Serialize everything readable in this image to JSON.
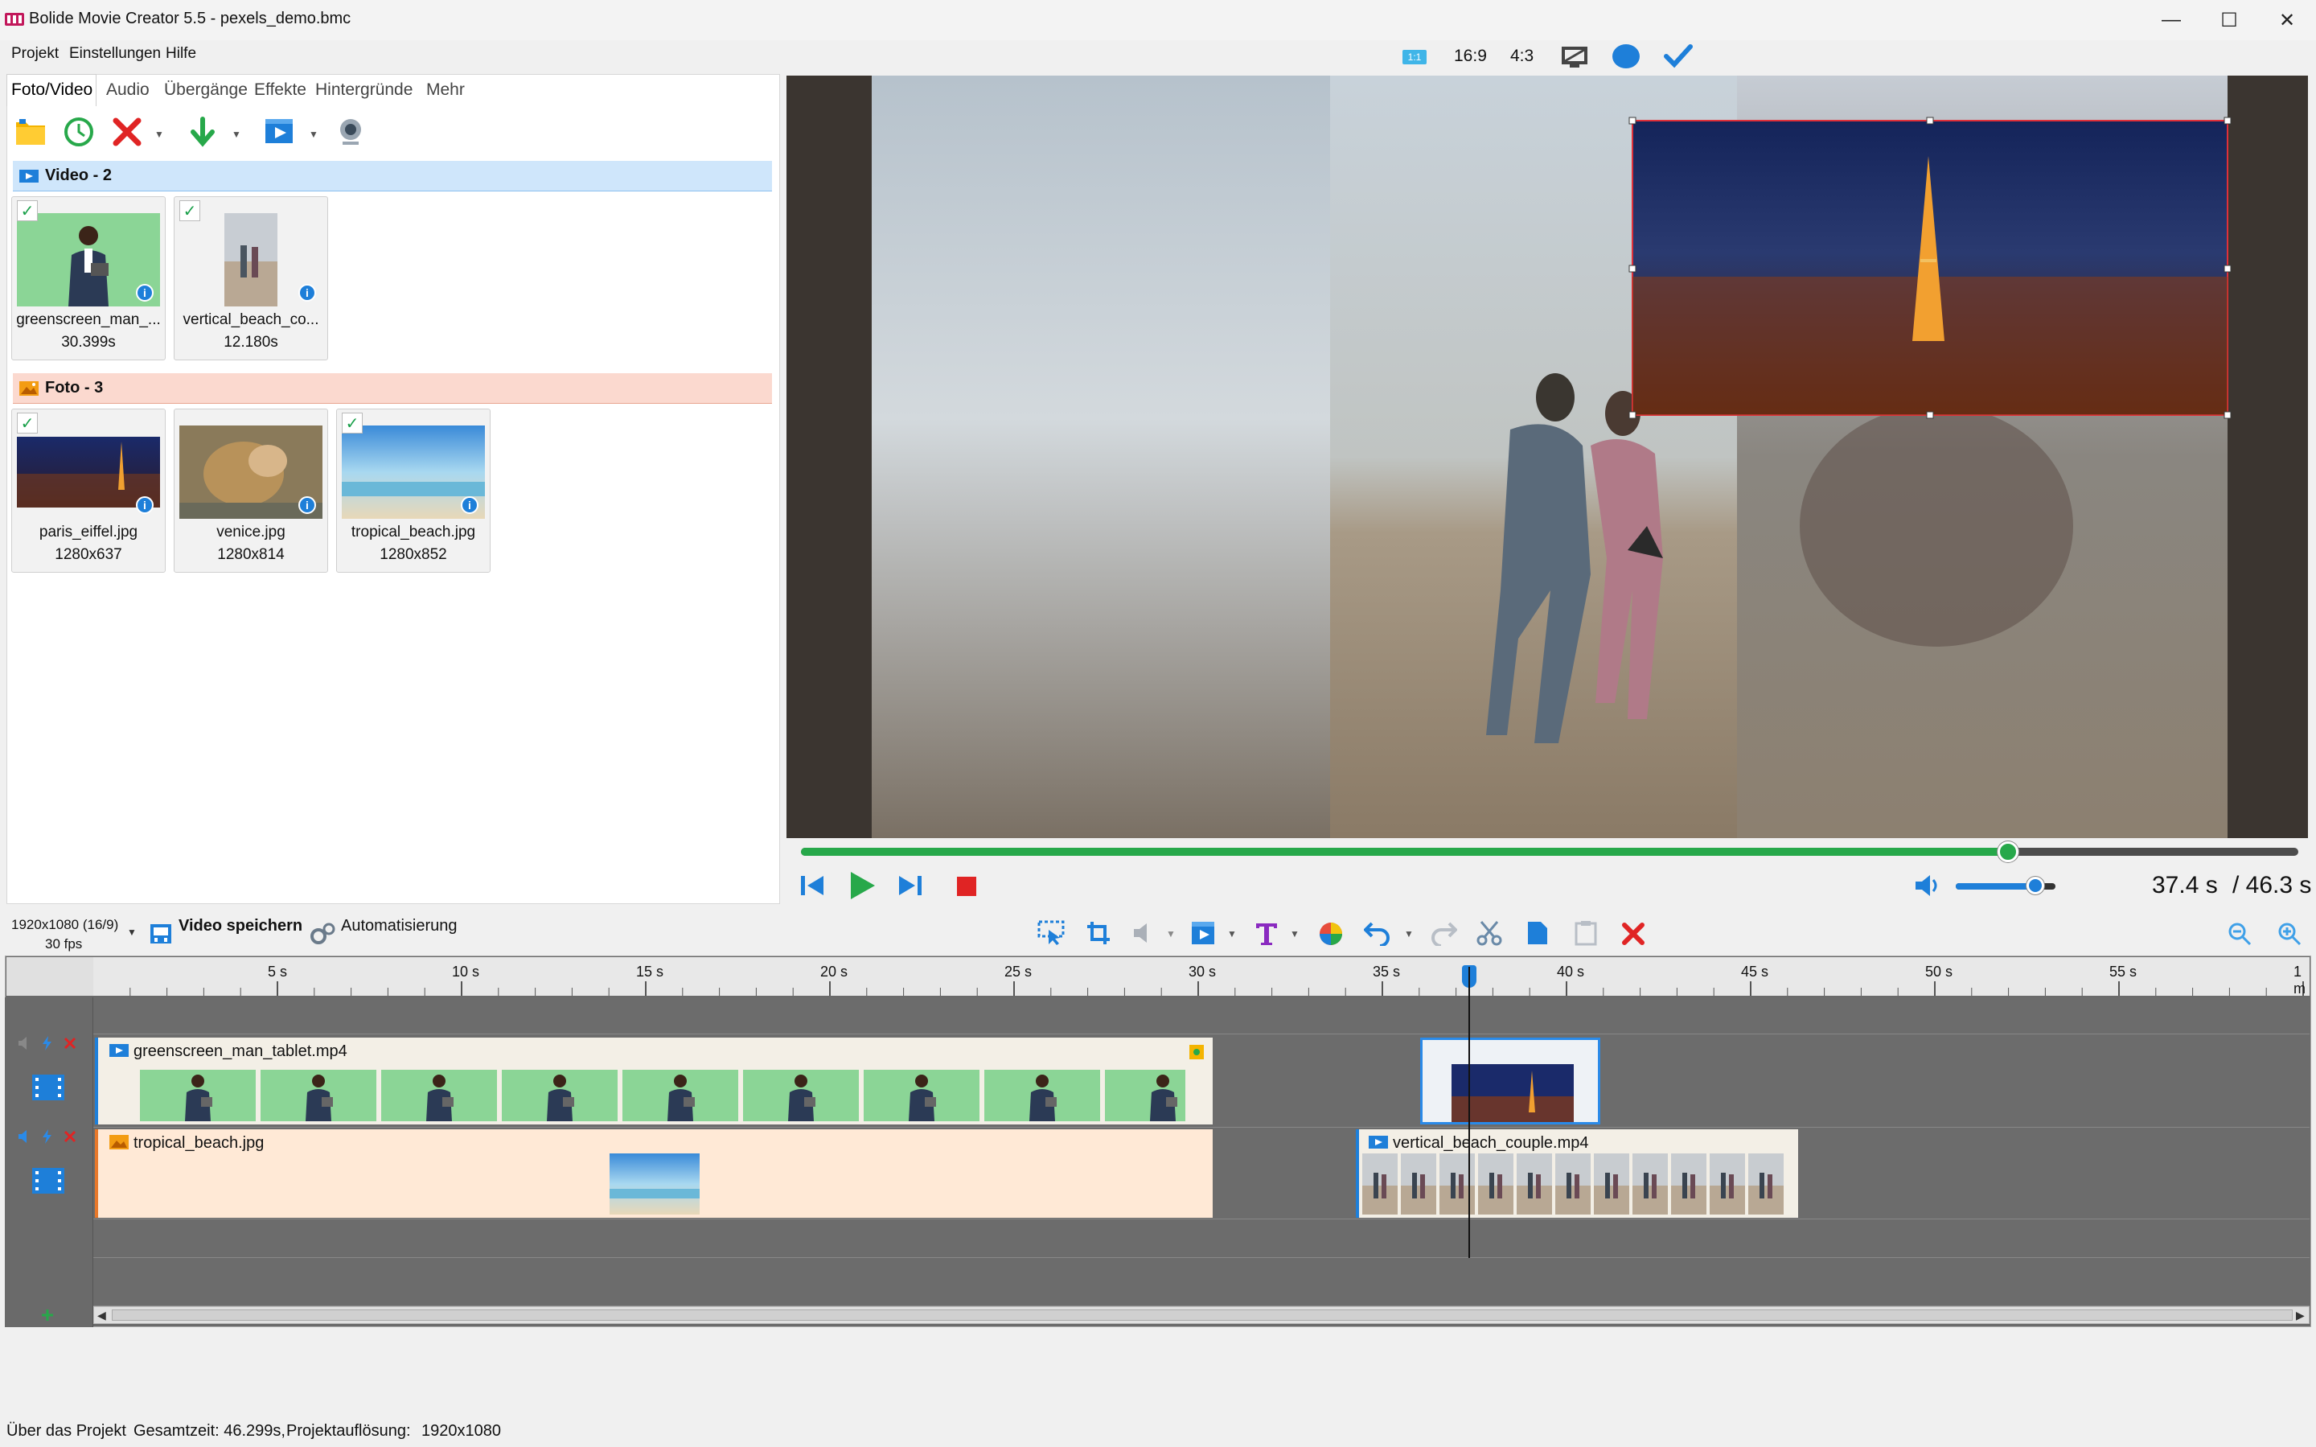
{
  "window": {
    "title": "Bolide Movie Creator 5.5 - pexels_demo.bmc",
    "minimize": "—",
    "maximize": "☐",
    "close": "✕"
  },
  "menu": [
    "Projekt",
    "Einstellungen",
    "Hilfe"
  ],
  "preview_toolbar": {
    "ratio_1_1": "1:1",
    "ratio_16_9": "16:9",
    "ratio_4_3": "4:3"
  },
  "tabs": [
    "Foto/Video",
    "Audio",
    "Übergänge",
    "Effekte",
    "Hintergründe",
    "Mehr"
  ],
  "groups": {
    "video": {
      "label": "Video - 2",
      "items": [
        {
          "name": "greenscreen_man_...",
          "info": "30.399s"
        },
        {
          "name": "vertical_beach_co...",
          "info": "12.180s"
        }
      ]
    },
    "photo": {
      "label": "Foto - 3",
      "items": [
        {
          "name": "paris_eiffel.jpg",
          "info": "1280x637"
        },
        {
          "name": "venice.jpg",
          "info": "1280x814"
        },
        {
          "name": "tropical_beach.jpg",
          "info": "1280x852"
        }
      ]
    }
  },
  "player": {
    "progress": 0.808,
    "volume": 0.78,
    "current_time": "37.4 s",
    "total_time": "/ 46.3 s"
  },
  "bottom_toolbar": {
    "resolution": "1920x1080 (16/9)",
    "fps": "30 fps",
    "save_video": "Video speichern",
    "automation": "Automatisierung"
  },
  "ruler": {
    "labels": [
      "5 s",
      "10 s",
      "15 s",
      "20 s",
      "25 s",
      "30 s",
      "35 s",
      "40 s",
      "45 s",
      "50 s",
      "55 s",
      "1 m"
    ]
  },
  "tracks": {
    "track1_clip1": "greenscreen_man_tablet.mp4",
    "track2_clip1": "tropical_beach.jpg",
    "track2_clip2": "vertical_beach_couple.mp4"
  },
  "statusbar": {
    "about": "Über das Projekt",
    "total_time": "Gesamtzeit: 46.299s,",
    "resolution_label": "Projektauflösung:",
    "resolution_value": "1920x1080"
  },
  "colors": {
    "accent_blue": "#1e7fd9",
    "seek_green": "#27a84a",
    "video_group": "#cfe6fb",
    "photo_group": "#fbd9cf",
    "clip_video_bg": "#f3efe6",
    "clip_photo_bg": "#ffe9d6"
  }
}
